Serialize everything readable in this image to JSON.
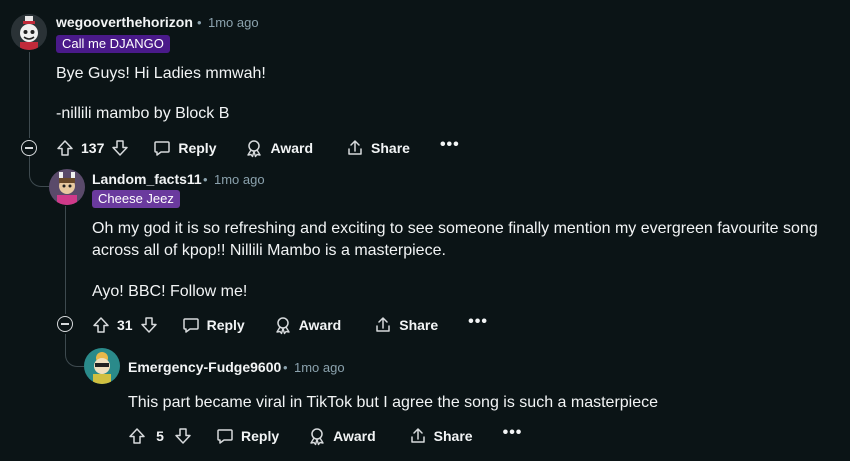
{
  "comments": [
    {
      "username": "wegooverthehorizon",
      "separator": "•",
      "time": "1mo ago",
      "flair": "Call me DJANGO",
      "flair_color": "#4a1a8a",
      "body": [
        "Bye Guys! Hi Ladies mmwah!",
        "-nillili mambo by Block B"
      ],
      "votes": "137",
      "reply_label": "Reply",
      "award_label": "Award",
      "share_label": "Share",
      "more_label": "•••"
    },
    {
      "username": "Landom_facts11",
      "separator": "•",
      "time": "1mo ago",
      "flair": "Cheese Jeez",
      "flair_color": "#6a3a9e",
      "body": [
        "Oh my god it is so refreshing and exciting to see someone finally mention my evergreen favourite song",
        "across all of kpop!! Nillili Mambo is a masterpiece.",
        "Ayo! BBC! Follow me!"
      ],
      "votes": "31",
      "reply_label": "Reply",
      "award_label": "Award",
      "share_label": "Share",
      "more_label": "•••"
    },
    {
      "username": "Emergency-Fudge9600",
      "separator": "•",
      "time": "1mo ago",
      "body": [
        "This part became viral in TikTok but I agree the song is such a masterpiece"
      ],
      "votes": "5",
      "reply_label": "Reply",
      "award_label": "Award",
      "share_label": "Share",
      "more_label": "•••"
    }
  ]
}
